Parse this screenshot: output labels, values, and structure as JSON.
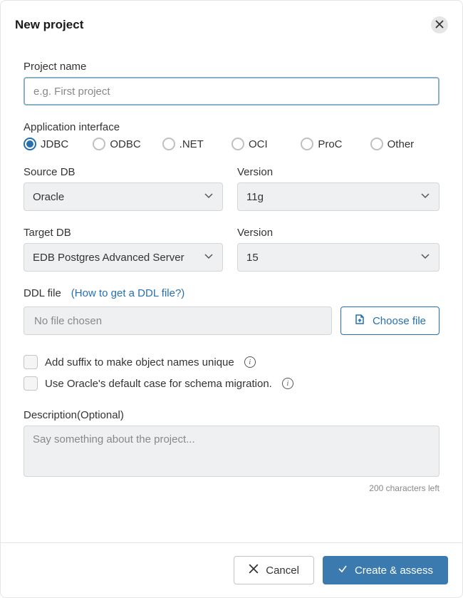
{
  "dialog": {
    "title": "New project"
  },
  "projectName": {
    "label": "Project name",
    "placeholder": "e.g. First project",
    "value": ""
  },
  "appInterface": {
    "label": "Application interface",
    "options": [
      {
        "label": "JDBC",
        "checked": true
      },
      {
        "label": "ODBC",
        "checked": false
      },
      {
        "label": ".NET",
        "checked": false
      },
      {
        "label": "OCI",
        "checked": false
      },
      {
        "label": "ProC",
        "checked": false
      },
      {
        "label": "Other",
        "checked": false
      }
    ]
  },
  "sourceDb": {
    "label": "Source DB",
    "value": "Oracle"
  },
  "sourceVersion": {
    "label": "Version",
    "value": "11g"
  },
  "targetDb": {
    "label": "Target DB",
    "value": "EDB Postgres Advanced Server"
  },
  "targetVersion": {
    "label": "Version",
    "value": "15"
  },
  "ddlFile": {
    "label": "DDL file",
    "helpLink": "(How to get a DDL file?)",
    "noFileText": "No file chosen",
    "chooseButton": "Choose file"
  },
  "options": {
    "suffix": "Add suffix to make object names unique",
    "defaultCase": "Use Oracle's default case for schema migration."
  },
  "description": {
    "label": "Description(Optional)",
    "placeholder": "Say something about the project...",
    "value": "",
    "charCount": "200 characters left"
  },
  "footer": {
    "cancel": "Cancel",
    "submit": "Create & assess"
  }
}
